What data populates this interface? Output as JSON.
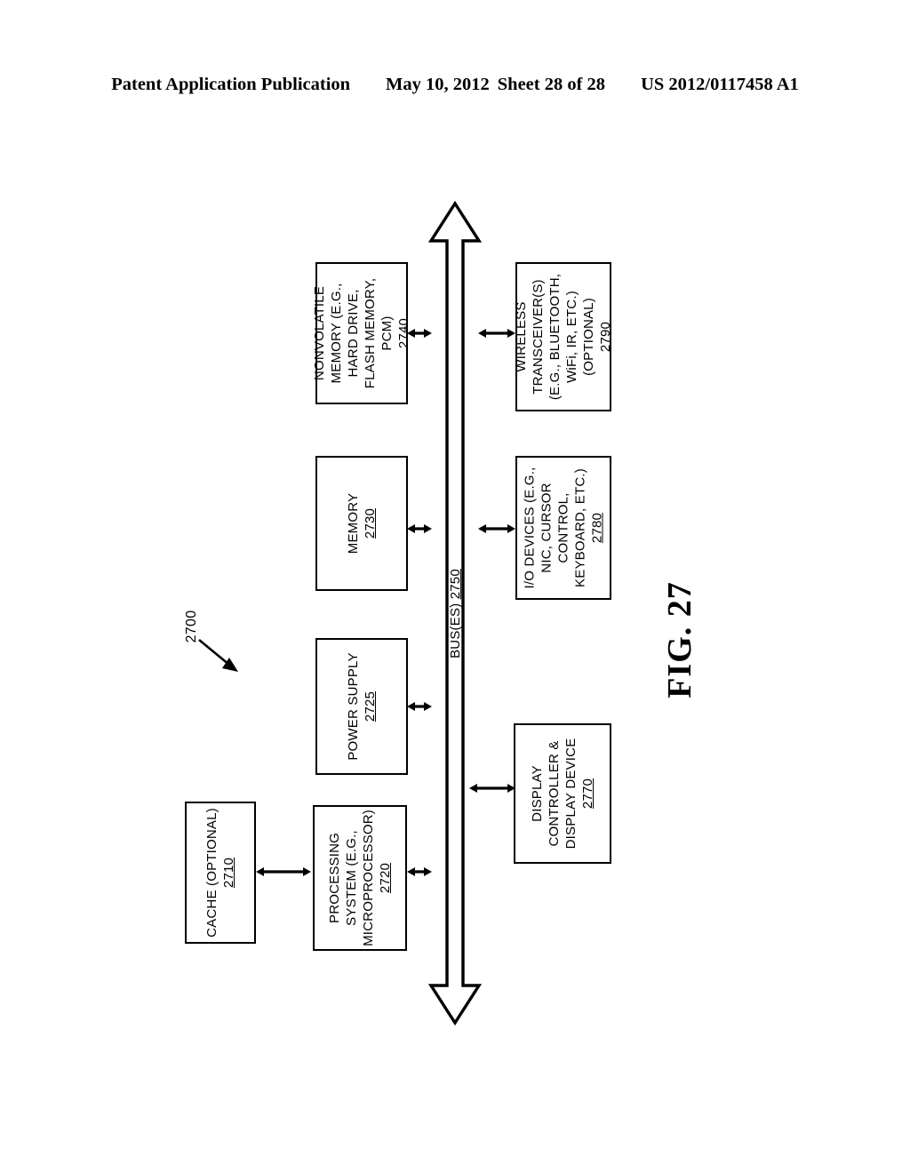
{
  "header": {
    "publication": "Patent Application Publication",
    "date": "May 10, 2012",
    "sheet": "Sheet 28 of 28",
    "number": "US 2012/0117458 A1"
  },
  "figure": {
    "label": "FIG. 27",
    "system_ref": "2700",
    "bus": {
      "name": "BUS(ES)",
      "ref": "2750",
      "ref_underlined": true
    },
    "nodes": [
      {
        "id": "cache",
        "lines": [
          "CACHE (OPTIONAL)"
        ],
        "ref": "2710",
        "ref_underlined": true
      },
      {
        "id": "processing-system",
        "lines": [
          "PROCESSING",
          "SYSTEM (E.G.,",
          "MICROPROCESSOR)"
        ],
        "ref": "2720",
        "ref_underlined": true
      },
      {
        "id": "power-supply",
        "lines": [
          "POWER SUPPLY"
        ],
        "ref": "2725",
        "ref_underlined": true
      },
      {
        "id": "memory",
        "lines": [
          "MEMORY"
        ],
        "ref": "2730",
        "ref_underlined": true
      },
      {
        "id": "nonvolatile-memory",
        "lines": [
          "NONVOLATILE",
          "MEMORY (E.G.,",
          "HARD DRIVE,",
          "FLASH MEMORY,",
          "PCM)"
        ],
        "ref": "2740",
        "ref_underlined": false
      },
      {
        "id": "display-controller",
        "lines": [
          "DISPLAY",
          "CONTROLLER &",
          "DISPLAY DEVICE"
        ],
        "ref": "2770",
        "ref_underlined": true
      },
      {
        "id": "io-devices",
        "lines": [
          "I/O DEVICES (E.G.,",
          "NIC, CURSOR",
          "CONTROL,",
          "KEYBOARD, ETC.)"
        ],
        "ref": "2780",
        "ref_underlined": true
      },
      {
        "id": "wireless-transceivers",
        "lines": [
          "WIRELESS",
          "TRANSCEIVER(S)",
          "(E.G., BLUETOOTH,",
          "WiFi, IR, ETC.)",
          "(OPTIONAL)"
        ],
        "ref": "2790",
        "ref_underlined": true
      }
    ],
    "colors": {
      "stroke": "#000000",
      "background": "#ffffff"
    }
  }
}
